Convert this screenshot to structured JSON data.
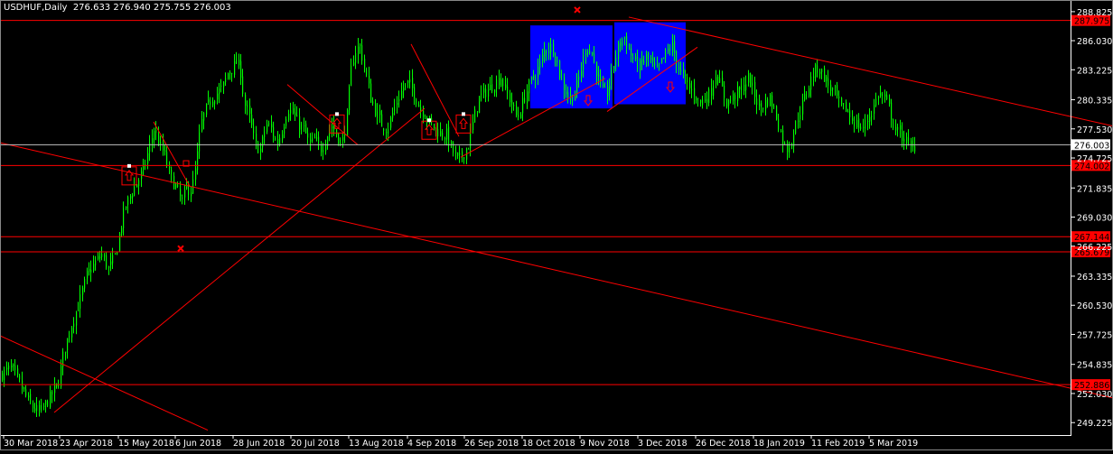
{
  "header": {
    "symbol": "USDHUF,Daily",
    "ohlc": "276.633 276.940 275.755 276.003"
  },
  "colors": {
    "background": "#000000",
    "candle": "#00ff00",
    "line": "#ff0000",
    "zone": "#0000ff",
    "axis_text": "#ffffff",
    "price_label_bg": "#ff0000",
    "current_price_line": "#c0c0c0"
  },
  "chart_data": {
    "type": "candlestick",
    "title": "USDHUF,Daily",
    "ylim": [
      248.2,
      289.6
    ],
    "grid": false,
    "x_tick_labels": [
      "30 Mar 2018",
      "23 Apr 2018",
      "15 May 2018",
      "6 Jun 2018",
      "28 Jun 2018",
      "20 Jul 2018",
      "13 Aug 2018",
      "4 Sep 2018",
      "26 Sep 2018",
      "18 Oct 2018",
      "9 Nov 2018",
      "3 Dec 2018",
      "26 Dec 2018",
      "18 Jan 2019",
      "11 Feb 2019",
      "5 Mar 2019"
    ],
    "y_tick_labels": [
      "288.825",
      "286.030",
      "283.225",
      "280.335",
      "277.530",
      "274.725",
      "271.835",
      "269.030",
      "266.225",
      "263.335",
      "260.530",
      "257.725",
      "254.835",
      "252.030",
      "249.225"
    ],
    "y_tick_values": [
      288.825,
      286.03,
      283.225,
      280.335,
      277.53,
      274.725,
      271.835,
      269.03,
      266.225,
      263.335,
      260.53,
      257.725,
      254.835,
      252.03,
      249.225
    ],
    "last_close": 276.003,
    "price_levels": [
      287.975,
      274.002,
      267.144,
      265.679,
      252.886
    ],
    "price_level_labels": [
      "287.975",
      "274.002",
      "267.144",
      "265.679",
      "252.886"
    ],
    "current_price_label": "276.003",
    "close_path": [
      [
        0,
        253.8
      ],
      [
        12,
        254.5
      ],
      [
        24,
        252.5
      ],
      [
        34,
        250.8
      ],
      [
        44,
        250.2
      ],
      [
        54,
        251.5
      ],
      [
        64,
        253.0
      ],
      [
        70,
        256.0
      ],
      [
        80,
        259.0
      ],
      [
        88,
        261.0
      ],
      [
        96,
        263.5
      ],
      [
        104,
        264.5
      ],
      [
        112,
        265.5
      ],
      [
        120,
        264.0
      ],
      [
        128,
        265.5
      ],
      [
        132,
        267.5
      ],
      [
        138,
        270.0
      ],
      [
        146,
        271.5
      ],
      [
        152,
        272.5
      ],
      [
        158,
        273.5
      ],
      [
        164,
        275.5
      ],
      [
        170,
        277.5
      ],
      [
        176,
        276.0
      ],
      [
        182,
        275.0
      ],
      [
        186,
        273.5
      ],
      [
        190,
        272.5
      ],
      [
        194,
        272.0
      ],
      [
        198,
        271.0
      ],
      [
        202,
        270.5
      ],
      [
        206,
        272.0
      ],
      [
        210,
        271.5
      ],
      [
        214,
        272.5
      ],
      [
        218,
        275.0
      ],
      [
        222,
        278.0
      ],
      [
        228,
        279.5
      ],
      [
        234,
        280.5
      ],
      [
        240,
        281.0
      ],
      [
        246,
        281.5
      ],
      [
        252,
        283.0
      ],
      [
        258,
        283.5
      ],
      [
        262,
        284.0
      ],
      [
        266,
        283.0
      ],
      [
        270,
        280.0
      ],
      [
        276,
        278.5
      ],
      [
        282,
        276.0
      ],
      [
        288,
        275.5
      ],
      [
        294,
        278.0
      ],
      [
        300,
        277.5
      ],
      [
        306,
        276.0
      ],
      [
        312,
        277.5
      ],
      [
        318,
        279.5
      ],
      [
        324,
        279.0
      ],
      [
        330,
        278.0
      ],
      [
        336,
        277.5
      ],
      [
        342,
        276.0
      ],
      [
        348,
        276.5
      ],
      [
        354,
        275.5
      ],
      [
        360,
        276.5
      ],
      [
        366,
        278.0
      ],
      [
        372,
        277.0
      ],
      [
        378,
        276.0
      ],
      [
        384,
        279.0
      ],
      [
        388,
        283.0
      ],
      [
        392,
        285.0
      ],
      [
        398,
        285.5
      ],
      [
        404,
        283.0
      ],
      [
        410,
        280.5
      ],
      [
        416,
        279.0
      ],
      [
        422,
        278.0
      ],
      [
        428,
        277.5
      ],
      [
        434,
        279.0
      ],
      [
        440,
        280.5
      ],
      [
        446,
        281.5
      ],
      [
        452,
        282.0
      ],
      [
        458,
        281.0
      ],
      [
        464,
        279.5
      ],
      [
        470,
        279.0
      ],
      [
        476,
        278.0
      ],
      [
        482,
        277.5
      ],
      [
        488,
        277.0
      ],
      [
        494,
        277.0
      ],
      [
        500,
        275.5
      ],
      [
        506,
        274.5
      ],
      [
        512,
        275.0
      ],
      [
        518,
        276.0
      ],
      [
        524,
        278.5
      ],
      [
        530,
        280.5
      ],
      [
        536,
        281.0
      ],
      [
        542,
        281.5
      ],
      [
        548,
        282.0
      ],
      [
        554,
        282.5
      ],
      [
        560,
        281.0
      ],
      [
        566,
        280.0
      ],
      [
        572,
        278.5
      ],
      [
        578,
        280.0
      ],
      [
        584,
        281.5
      ],
      [
        590,
        282.5
      ],
      [
        596,
        283.5
      ],
      [
        602,
        285.0
      ],
      [
        608,
        285.5
      ],
      [
        614,
        285.0
      ],
      [
        618,
        283.0
      ],
      [
        624,
        281.5
      ],
      [
        630,
        280.5
      ],
      [
        636,
        281.0
      ],
      [
        642,
        283.0
      ],
      [
        648,
        285.5
      ],
      [
        654,
        285.0
      ],
      [
        660,
        283.0
      ],
      [
        666,
        281.0
      ],
      [
        672,
        281.0
      ],
      [
        678,
        283.5
      ],
      [
        684,
        285.5
      ],
      [
        690,
        286.5
      ],
      [
        696,
        285.0
      ],
      [
        702,
        284.0
      ],
      [
        708,
        283.5
      ],
      [
        714,
        284.5
      ],
      [
        720,
        284.0
      ],
      [
        726,
        283.0
      ],
      [
        732,
        284.0
      ],
      [
        738,
        285.0
      ],
      [
        744,
        285.5
      ],
      [
        750,
        283.5
      ],
      [
        756,
        282.5
      ],
      [
        762,
        281.5
      ],
      [
        768,
        281.0
      ],
      [
        774,
        280.0
      ],
      [
        780,
        280.5
      ],
      [
        786,
        281.0
      ],
      [
        792,
        283.0
      ],
      [
        798,
        281.5
      ],
      [
        804,
        280.0
      ],
      [
        810,
        280.5
      ],
      [
        816,
        281.0
      ],
      [
        822,
        281.5
      ],
      [
        828,
        282.5
      ],
      [
        834,
        281.0
      ],
      [
        840,
        279.5
      ],
      [
        846,
        280.0
      ],
      [
        852,
        280.5
      ],
      [
        858,
        279.0
      ],
      [
        864,
        277.0
      ],
      [
        870,
        275.5
      ],
      [
        876,
        276.5
      ],
      [
        882,
        278.5
      ],
      [
        888,
        280.0
      ],
      [
        894,
        281.5
      ],
      [
        900,
        283.0
      ],
      [
        906,
        283.5
      ],
      [
        912,
        282.5
      ],
      [
        918,
        281.5
      ],
      [
        924,
        281.0
      ],
      [
        930,
        279.5
      ],
      [
        936,
        279.5
      ],
      [
        942,
        278.5
      ],
      [
        948,
        278.0
      ],
      [
        954,
        277.5
      ],
      [
        960,
        278.5
      ],
      [
        966,
        279.5
      ],
      [
        972,
        281.0
      ],
      [
        978,
        280.5
      ],
      [
        984,
        279.5
      ],
      [
        990,
        277.5
      ],
      [
        996,
        277.0
      ],
      [
        1002,
        276.5
      ],
      [
        1008,
        275.5
      ],
      [
        1014,
        276.0
      ]
    ],
    "trend_lines": [
      [
        [
          0,
          276.2
        ],
        [
          1232,
          251.6
        ]
      ],
      [
        [
          0,
          257.6
        ],
        [
          230,
          248.5
        ]
      ],
      [
        [
          60,
          250.2
        ],
        [
          470,
          279.5
        ]
      ],
      [
        [
          170,
          278.2
        ],
        [
          210,
          272.0
        ]
      ],
      [
        [
          318,
          281.8
        ],
        [
          396,
          276.0
        ]
      ],
      [
        [
          455,
          285.7
        ],
        [
          508,
          276.8
        ]
      ],
      [
        [
          510,
          274.8
        ],
        [
          670,
          282.4
        ]
      ],
      [
        [
          672,
          279.2
        ],
        [
          772,
          285.4
        ]
      ],
      [
        [
          696,
          288.3
        ],
        [
          1232,
          277.8
        ]
      ]
    ],
    "zones": [
      {
        "x": [
          587,
          678
        ],
        "y": [
          279.5,
          287.5
        ]
      },
      {
        "x": [
          680,
          759
        ],
        "y": [
          279.9,
          287.8
        ]
      }
    ],
    "markers": [
      {
        "type": "up-arrow",
        "x": 143,
        "y": 273.0
      },
      {
        "type": "up-arrow",
        "x": 373,
        "y": 278.0
      },
      {
        "type": "up-arrow",
        "x": 475,
        "y": 277.4
      },
      {
        "type": "up-arrow",
        "x": 513,
        "y": 278.0
      },
      {
        "type": "down-arrow",
        "x": 651,
        "y": 280.3
      },
      {
        "type": "down-arrow",
        "x": 742,
        "y": 281.6
      },
      {
        "type": "small-marker",
        "x": 206,
        "y": 274.2
      },
      {
        "type": "cross",
        "x": 639,
        "y": 289.0
      },
      {
        "type": "cross",
        "x": 200,
        "y": 266.0
      }
    ]
  }
}
